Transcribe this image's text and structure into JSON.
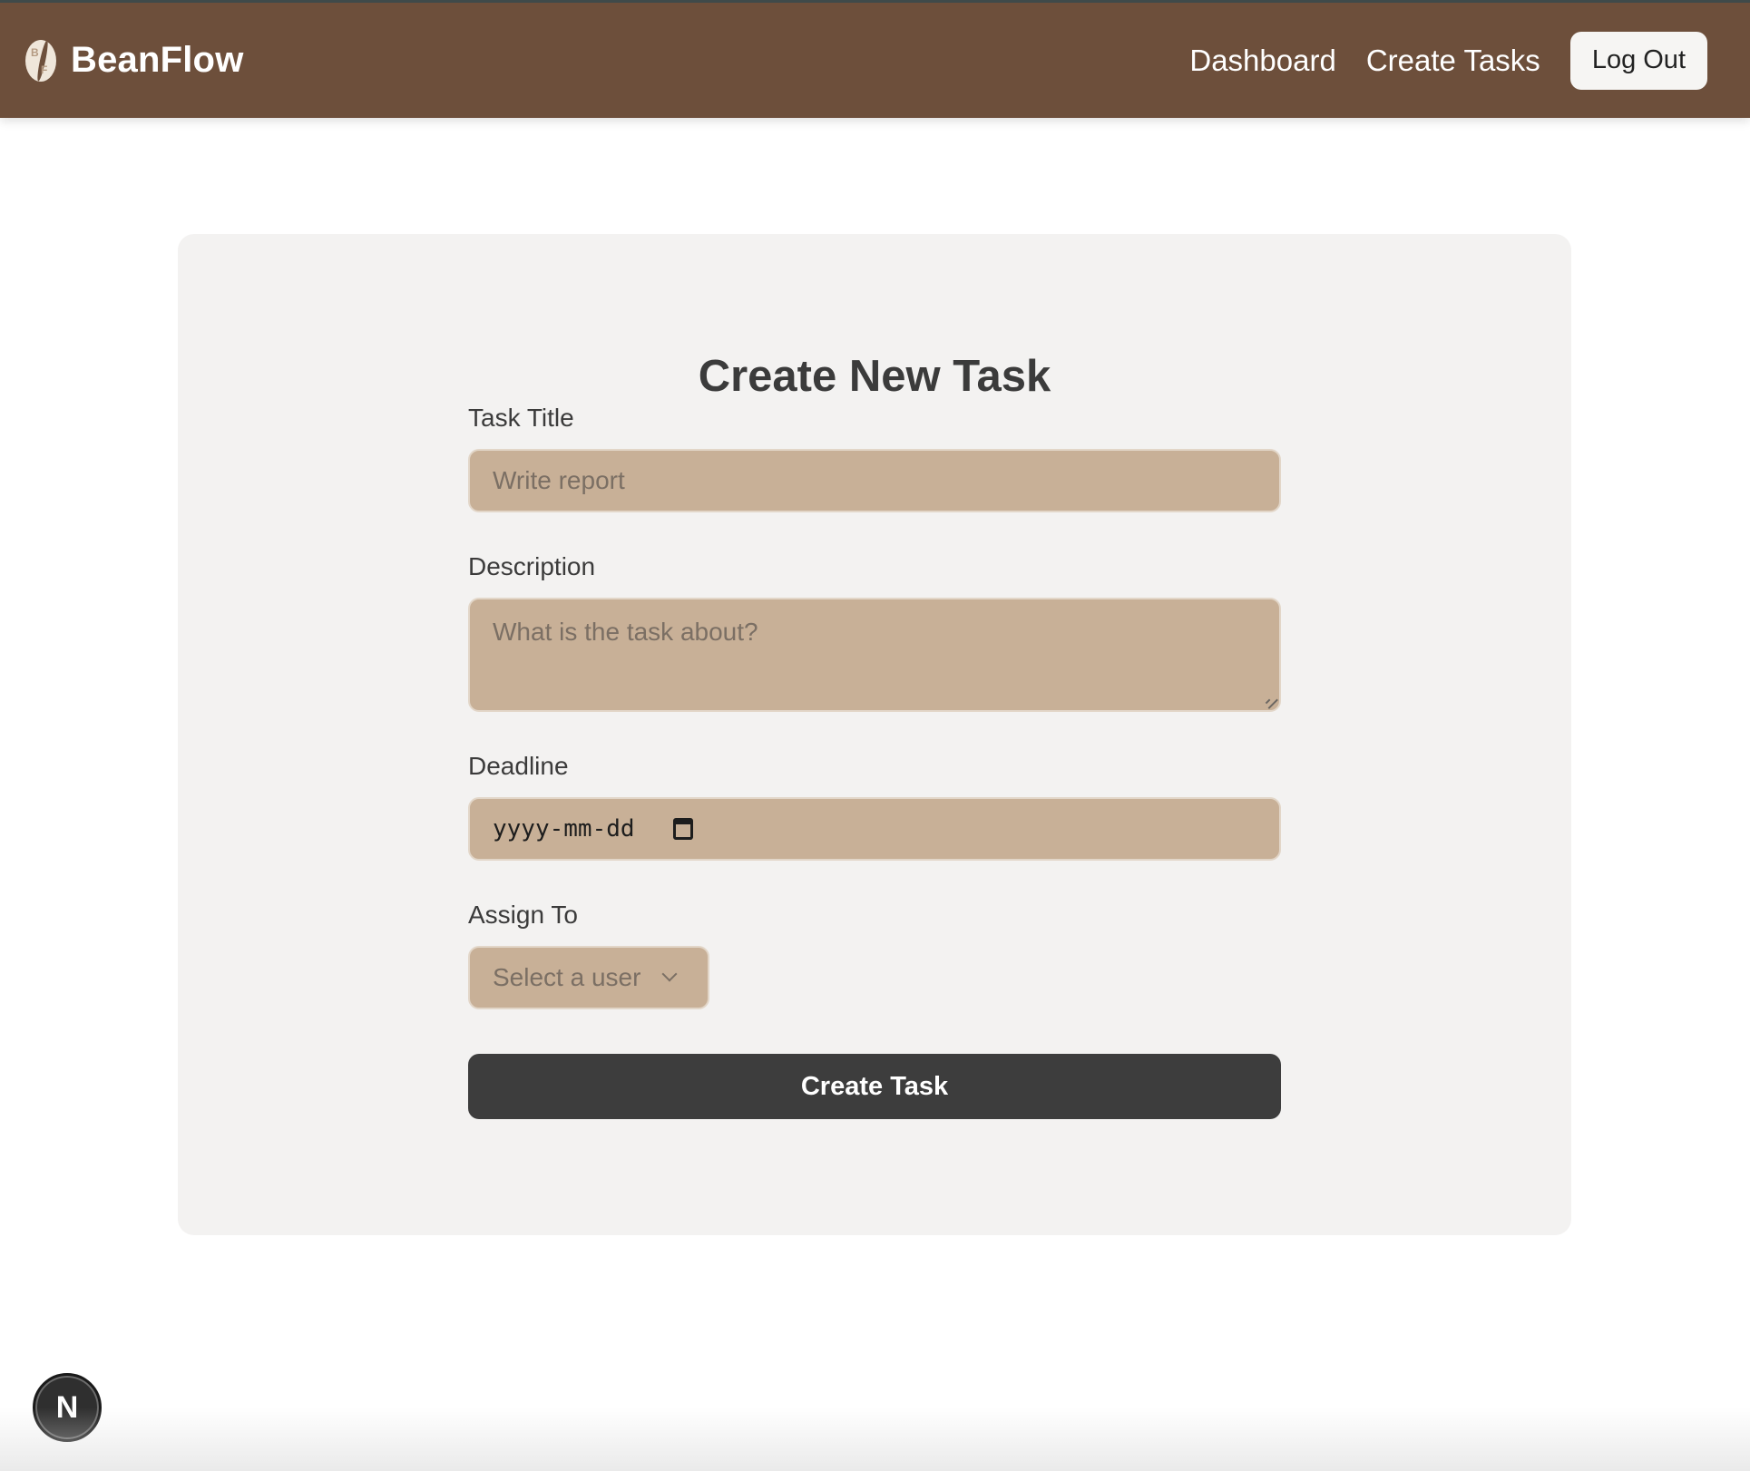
{
  "navbar": {
    "brand": "BeanFlow",
    "logo_letters": [
      "B",
      "F"
    ],
    "links": [
      "Dashboard",
      "Create Tasks"
    ],
    "logout_label": "Log Out"
  },
  "form": {
    "title": "Create New Task",
    "task_title": {
      "label": "Task Title",
      "placeholder": "Write report"
    },
    "description": {
      "label": "Description",
      "placeholder": "What is the task about?"
    },
    "deadline": {
      "label": "Deadline",
      "value": "yyyy-mm-dd"
    },
    "assign_to": {
      "label": "Assign To",
      "selected": "Select a user"
    },
    "submit_label": "Create Task"
  },
  "dev_badge": {
    "letter": "N"
  },
  "colors": {
    "navbar": "#6d4f3b",
    "field": "#c8b097",
    "card": "#f3f2f1",
    "button": "#3d3d3d"
  }
}
